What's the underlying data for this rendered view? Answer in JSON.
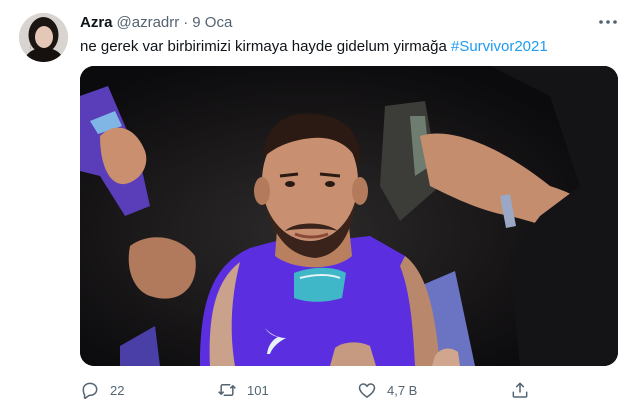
{
  "tweet": {
    "author_name": "Azra",
    "author_handle": "@azradrr",
    "separator": "·",
    "date": "9 Oca",
    "text_plain": "ne gerek var birbirimizi kirmaya hayde gidelum yirmağa ",
    "hashtag": "#Survivor2021",
    "more_icon": "more-horizontal-icon"
  },
  "actions": {
    "reply": {
      "icon": "reply-icon",
      "count": "22"
    },
    "retweet": {
      "icon": "retweet-icon",
      "count": "101"
    },
    "like": {
      "icon": "heart-icon",
      "count": "4,7 B"
    },
    "share": {
      "icon": "share-icon"
    }
  },
  "colors": {
    "text": "#0f1419",
    "secondary": "#536471",
    "link": "#1d9bf0",
    "jersey": "#5b2fe0"
  }
}
